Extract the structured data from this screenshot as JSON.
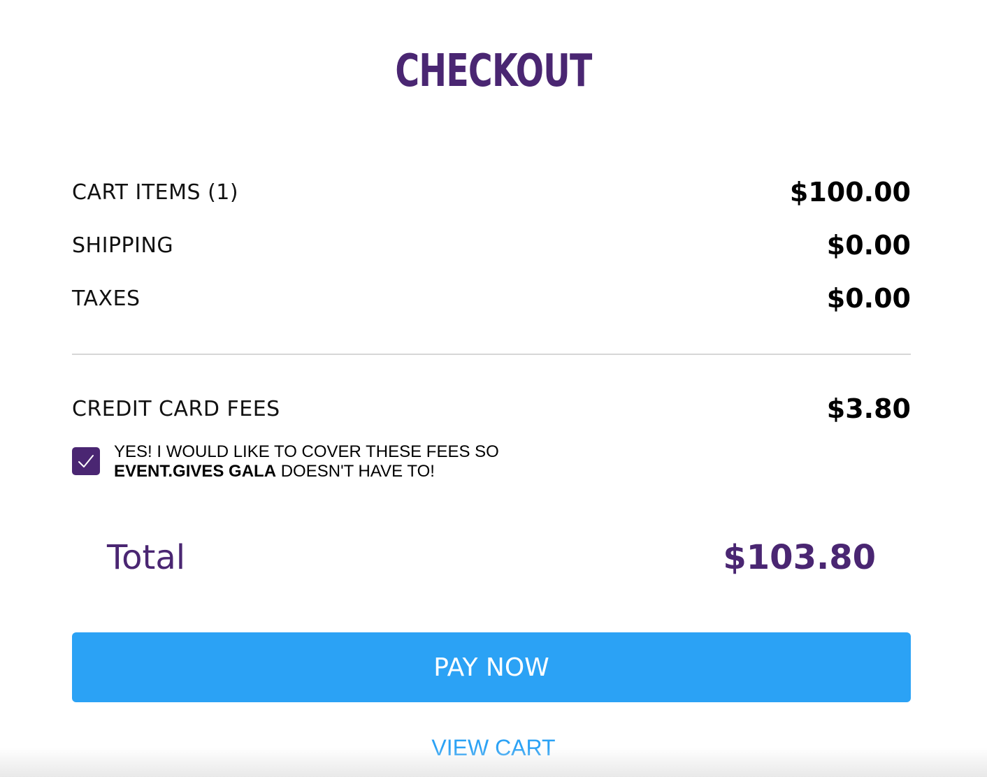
{
  "header": {
    "title": "CHECKOUT",
    "logo_icon": "logo-ring-icon",
    "brand_color": "#4a2672"
  },
  "summary": {
    "items": [
      {
        "label": "CART ITEMS (1)",
        "amount": "$100.00"
      },
      {
        "label": "SHIPPING",
        "amount": "$0.00"
      },
      {
        "label": "TAXES",
        "amount": "$0.00"
      }
    ]
  },
  "fees": {
    "label": "CREDIT CARD FEES",
    "amount": "$3.80",
    "cover_checked": true,
    "cover_text_pre": "YES! I WOULD LIKE TO COVER THESE FEES SO",
    "cover_org": "EVENT.GIVES GALA",
    "cover_text_post": "DOESN'T HAVE TO!"
  },
  "total": {
    "label": "Total",
    "amount": "$103.80"
  },
  "actions": {
    "pay_label": "PAY NOW",
    "pay_color": "#2ba2f5",
    "view_cart_label": "VIEW CART"
  }
}
